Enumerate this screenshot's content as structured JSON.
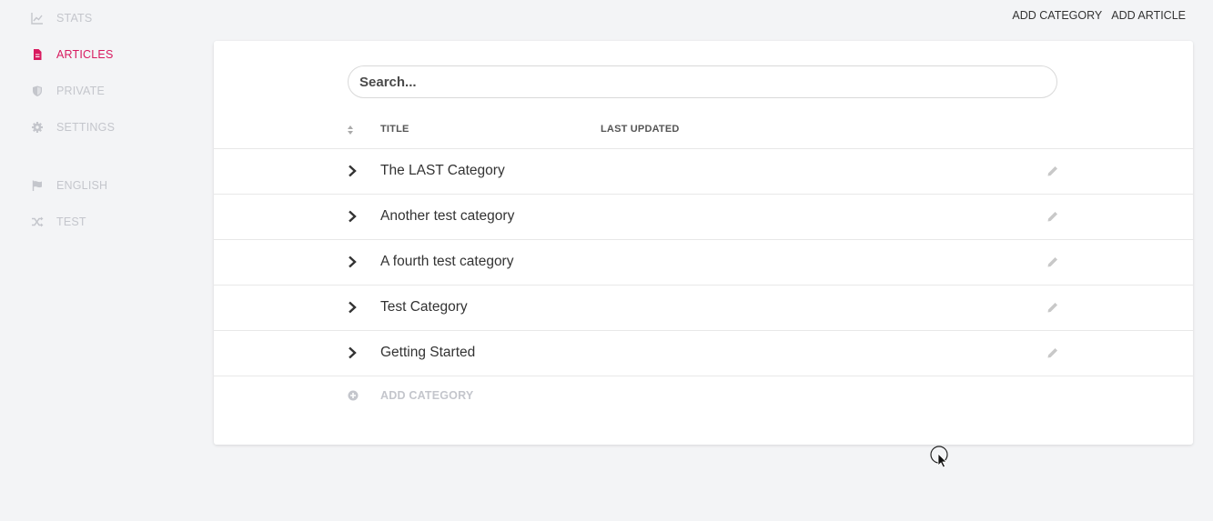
{
  "sidebar": {
    "items": [
      {
        "label": "STATS",
        "icon": "chart-line-icon"
      },
      {
        "label": "ARTICLES",
        "icon": "document-icon"
      },
      {
        "label": "PRIVATE",
        "icon": "shield-icon"
      },
      {
        "label": "SETTINGS",
        "icon": "gear-icon"
      },
      {
        "label": "ENGLISH",
        "icon": "flag-icon"
      },
      {
        "label": "TEST",
        "icon": "shuffle-icon"
      }
    ]
  },
  "header": {
    "add_category": "ADD CATEGORY",
    "add_article": "ADD ARTICLE"
  },
  "search": {
    "placeholder": "Search..."
  },
  "table": {
    "columns": {
      "title": "TITLE",
      "last_updated": "LAST UPDATED"
    },
    "rows": [
      {
        "title": "The LAST Category"
      },
      {
        "title": "Another test category"
      },
      {
        "title": "A fourth test category"
      },
      {
        "title": "Test Category"
      },
      {
        "title": "Getting Started"
      }
    ],
    "add_label": "ADD CATEGORY"
  },
  "colors": {
    "accent": "#d81b60",
    "muted": "#c4c6cc",
    "background": "#f3f4f6"
  }
}
